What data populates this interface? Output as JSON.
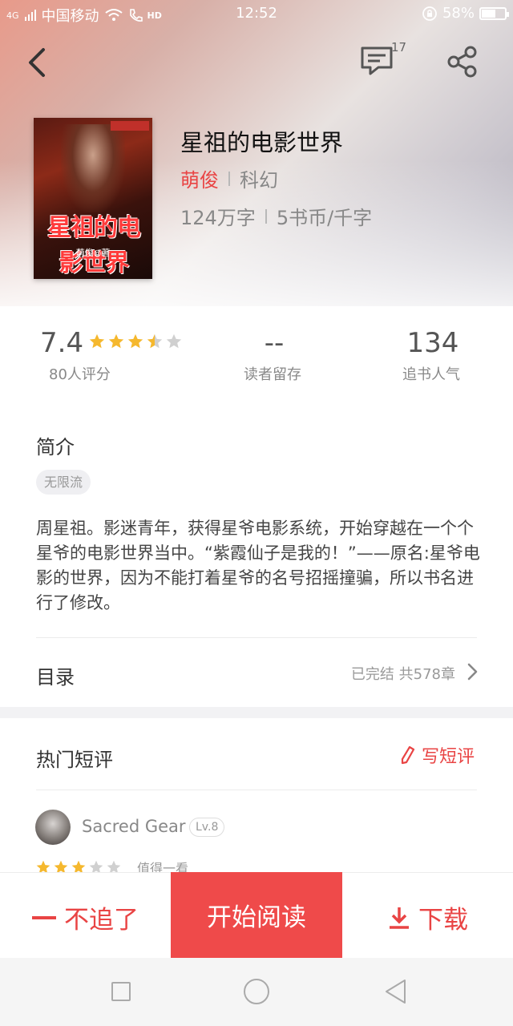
{
  "status_bar": {
    "network": "4G",
    "carrier": "中国移动",
    "hd": "HD",
    "time": "12:52",
    "battery": "58%",
    "battery_level": 0.58
  },
  "nav": {
    "comment_count": "17",
    "back_icon": "chevron-left-icon",
    "comments_icon": "comment-icon",
    "share_icon": "share-icon"
  },
  "book": {
    "title": "星祖的电影世界",
    "author": "萌俊",
    "genre": "科幻",
    "word_count": "124万字",
    "price": "5书币/千字",
    "cover": {
      "title": "星祖的电影世界",
      "author": "萌俊◎著"
    }
  },
  "stats": {
    "score": "7.4",
    "stars": 3.5,
    "ratings_label": "80人评分",
    "retention_value": "--",
    "retention_label": "读者留存",
    "popularity_value": "134",
    "popularity_label": "追书人气"
  },
  "intro": {
    "title": "简介",
    "tag": "无限流",
    "text": "周星祖。影迷青年，获得星爷电影系统，开始穿越在一个个星爷的电影世界当中。“紫霞仙子是我的！”——原名:星爷电影的世界，因为不能打着星爷的名号招摇撞骗，所以书名进行了修改。"
  },
  "toc": {
    "title": "目录",
    "status": "已完结  共578章"
  },
  "reviews": {
    "title": "热门短评",
    "write_label": "写短评",
    "first": {
      "name": "Sacred Gear",
      "level": "Lv.8",
      "stars": 3,
      "snippet": "值得一看"
    }
  },
  "actions": {
    "unfollow": "不追了",
    "read": "开始阅读",
    "download": "下载"
  },
  "colors": {
    "accent": "#ef4a4a",
    "star": "#f5b82e",
    "star_empty": "#d0d0d0"
  }
}
